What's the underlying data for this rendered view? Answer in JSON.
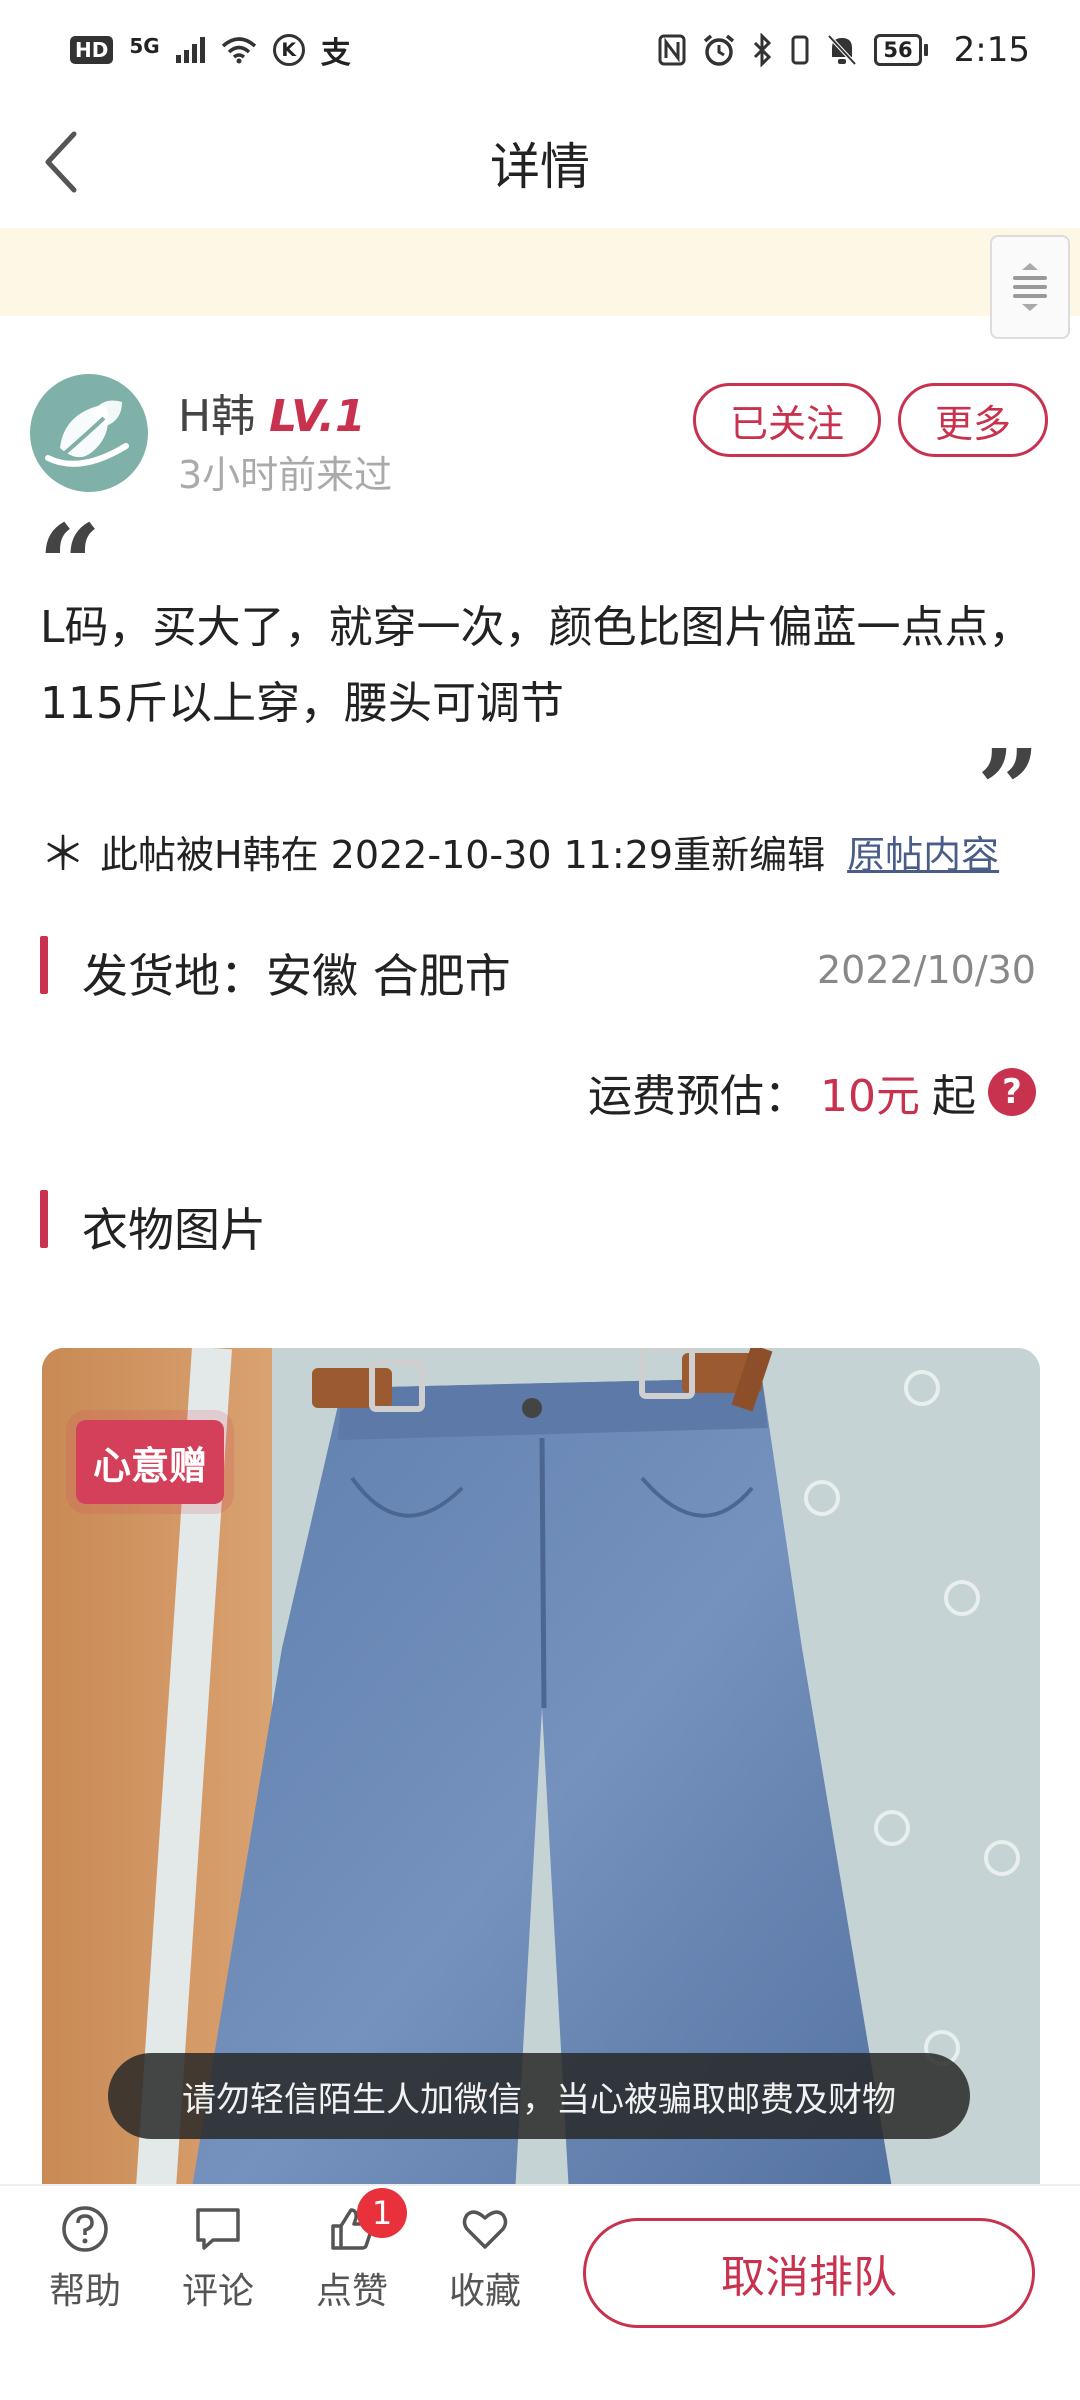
{
  "status_bar": {
    "hd": "HD",
    "network": "5G",
    "k_icon": "K",
    "alipay_icon": "支",
    "battery": "56",
    "time": "2:15"
  },
  "nav": {
    "title": "详情"
  },
  "user": {
    "name": "H韩",
    "level": "LV.1",
    "last_seen": "3小时前来过",
    "follow_label": "已关注",
    "more_label": "更多"
  },
  "post": {
    "body": "L码，买大了，就穿一次，颜色比图片偏蓝一点点，115斤以上穿，腰头可调节",
    "edit_star": "＊",
    "edit_note": "此帖被H韩在 2022-10-30 11:29重新编辑",
    "original_link": "原帖内容"
  },
  "shipping": {
    "from": "发货地：安徽 合肥市",
    "date": "2022/10/30",
    "fee_label": "运费预估：",
    "fee_value": "10元",
    "fee_suffix": "起",
    "help_icon_glyph": "?"
  },
  "photos": {
    "title": "衣物图片",
    "stamp": "心意赠",
    "warning": "请勿轻信陌生人加微信，当心被骗取邮费及财物"
  },
  "bottom_bar": {
    "help_label": "帮助",
    "comment_label": "评论",
    "like_label": "点赞",
    "like_count": "1",
    "favorite_label": "收藏",
    "cancel_label": "取消排队"
  },
  "colors": {
    "accent": "#c8324e",
    "notice_bg": "#fdf8e6",
    "badge_red": "#e8313a"
  }
}
